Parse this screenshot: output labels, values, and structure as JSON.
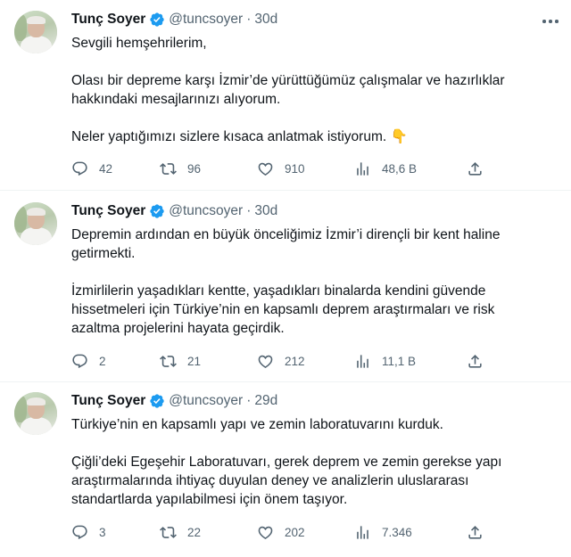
{
  "tweets": [
    {
      "author_name": "Tunç Soyer",
      "handle": "@tuncsoyer",
      "time": "30d",
      "paragraphs": [
        [
          "Sevgili hemşehrilerim,"
        ],
        [
          "Olası bir depreme karşı İzmir’de yürüttüğümüz çalışmalar ve hazırlıklar",
          "hakkındaki mesajlarınızı alıyorum."
        ],
        [
          "Neler yaptığımızı sizlere kısaca anlatmak istiyorum. 👇"
        ]
      ],
      "replies": "42",
      "retweets": "96",
      "likes": "910",
      "views": "48,6 B"
    },
    {
      "author_name": "Tunç Soyer",
      "handle": "@tuncsoyer",
      "time": "30d",
      "paragraphs": [
        [
          "Depremin ardından en büyük önceliğimiz İzmir’i dirençli bir kent haline",
          "getirmekti."
        ],
        [
          "İzmirlilerin yaşadıkları kentte, yaşadıkları binalarda kendini güvende",
          "hissetmeleri için Türkiye’nin en kapsamlı deprem araştırmaları ve risk",
          "azaltma projelerini hayata geçirdik."
        ]
      ],
      "replies": "2",
      "retweets": "21",
      "likes": "212",
      "views": "11,1 B"
    },
    {
      "author_name": "Tunç Soyer",
      "handle": "@tuncsoyer",
      "time": "29d",
      "paragraphs": [
        [
          "Türkiye’nin en kapsamlı yapı ve zemin laboratuvarını kurduk."
        ],
        [
          "Çiğli’deki Egeşehir Laboratuvarı, gerek deprem ve zemin gerekse yapı",
          "araştırmalarında ihtiyaç duyulan deney ve analizlerin uluslararası",
          "standartlarda yapılabilmesi için önem taşıyor."
        ]
      ],
      "replies": "3",
      "retweets": "22",
      "likes": "202",
      "views": "7.346"
    }
  ],
  "icons": {
    "verified": "verified-badge-icon",
    "more": "more-horizontal-icon",
    "reply": "reply-bubble-icon",
    "retweet": "retweet-icon",
    "like": "heart-icon",
    "views": "views-bar-chart-icon",
    "share": "share-upload-icon"
  },
  "colors": {
    "text": "#0f1419",
    "secondary": "#536471",
    "verified_blue": "#1d9bf0",
    "divider": "#eff3f4"
  }
}
